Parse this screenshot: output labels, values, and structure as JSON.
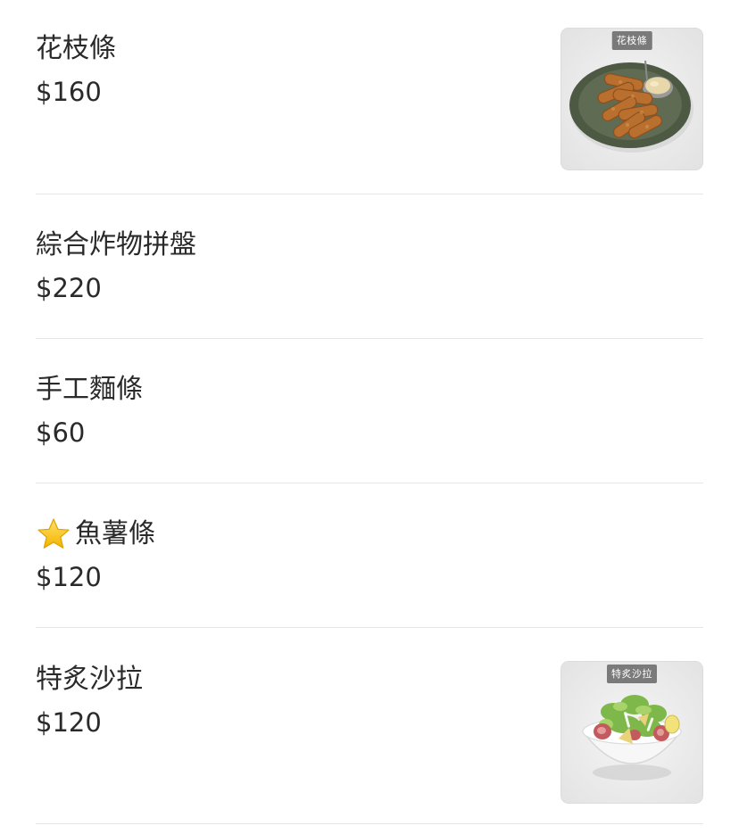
{
  "menu": {
    "items": [
      {
        "name": "花枝條",
        "price": "$160",
        "image_label": "花枝條",
        "has_star": false
      },
      {
        "name": "綜合炸物拼盤",
        "price": "$220",
        "has_star": false
      },
      {
        "name": "手工麵條",
        "price": "$60",
        "has_star": false
      },
      {
        "name": "魚薯條",
        "price": "$120",
        "has_star": true,
        "icon": "star-icon"
      },
      {
        "name": "特炙沙拉",
        "price": "$120",
        "image_label": "特炙沙拉",
        "has_star": false
      }
    ]
  },
  "colors": {
    "text": "#2a2a2a",
    "divider": "#e6e6e6",
    "label_bg": "#7a7a7a",
    "plate": "#55604a",
    "star": "#f7c21c"
  }
}
